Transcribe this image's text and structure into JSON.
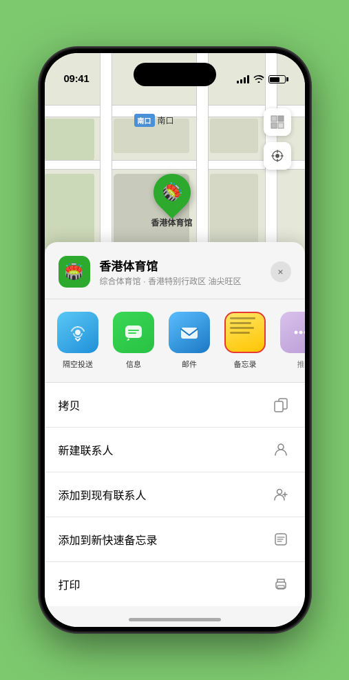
{
  "status_bar": {
    "time": "09:41",
    "location_arrow": "▶"
  },
  "map": {
    "south_entrance_box": "南口",
    "stadium_name": "香港体育馆"
  },
  "place_header": {
    "name": "香港体育馆",
    "subtitle": "综合体育馆 · 香港特别行政区 油尖旺区",
    "close_label": "×"
  },
  "share_items": [
    {
      "id": "airdrop",
      "label": "隔空投送",
      "icon": "📡"
    },
    {
      "id": "message",
      "label": "信息",
      "icon": "💬"
    },
    {
      "id": "mail",
      "label": "邮件",
      "icon": "✉️"
    },
    {
      "id": "notes",
      "label": "备忘录",
      "icon": ""
    },
    {
      "id": "more",
      "label": "推",
      "icon": "···"
    }
  ],
  "actions": [
    {
      "label": "拷贝",
      "icon": "copy"
    },
    {
      "label": "新建联系人",
      "icon": "person"
    },
    {
      "label": "添加到现有联系人",
      "icon": "person-add"
    },
    {
      "label": "添加到新快速备忘录",
      "icon": "memo"
    },
    {
      "label": "打印",
      "icon": "print"
    }
  ]
}
